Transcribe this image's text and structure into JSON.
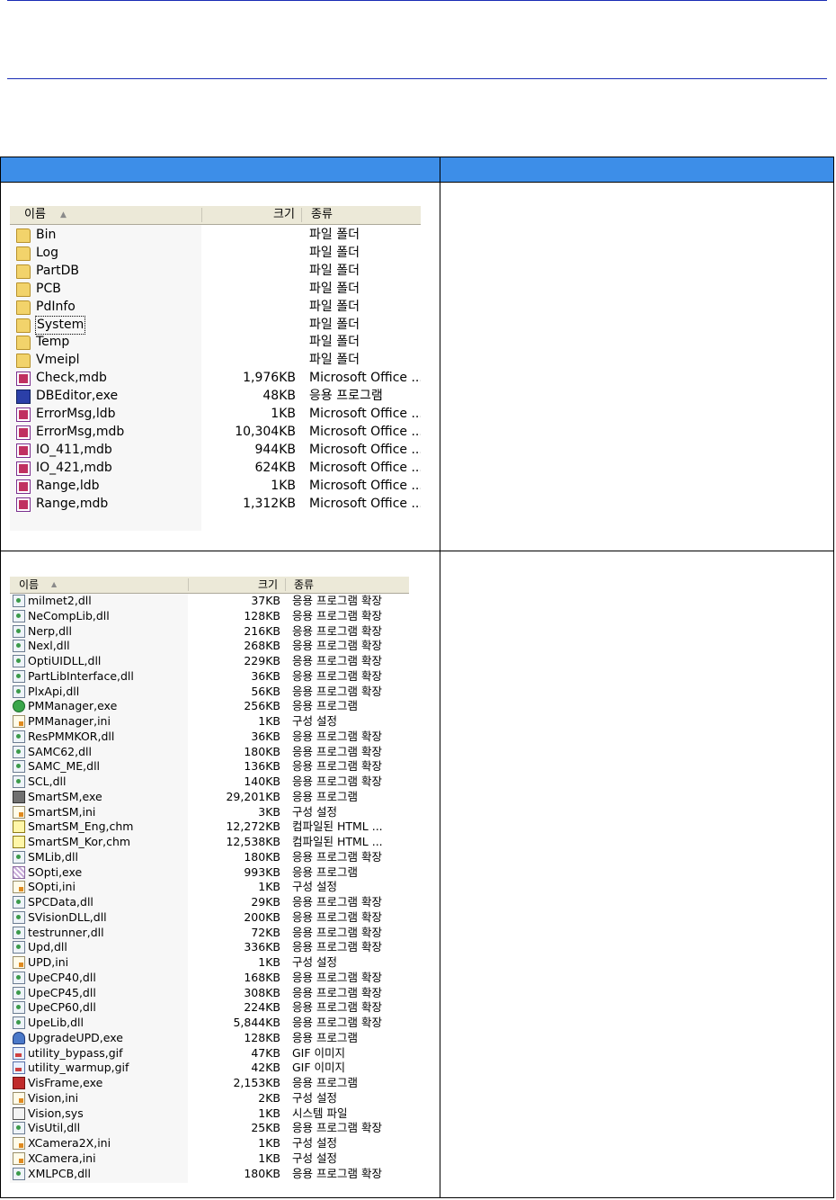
{
  "pane1": {
    "header": {
      "name": "이름",
      "size": "크기",
      "type": "종류"
    },
    "rows": [
      {
        "icon": "folder-icon",
        "name": "Bin",
        "size": "",
        "type": "파일 폴더"
      },
      {
        "icon": "folder-icon",
        "name": "Log",
        "size": "",
        "type": "파일 폴더"
      },
      {
        "icon": "folder-icon",
        "name": "PartDB",
        "size": "",
        "type": "파일 폴더"
      },
      {
        "icon": "folder-icon",
        "name": "PCB",
        "size": "",
        "type": "파일 폴더"
      },
      {
        "icon": "folder-icon",
        "name": "PdInfo",
        "size": "",
        "type": "파일 폴더"
      },
      {
        "icon": "folder-icon",
        "name": "System",
        "size": "",
        "type": "파일 폴더",
        "focused": true
      },
      {
        "icon": "folder-icon",
        "name": "Temp",
        "size": "",
        "type": "파일 폴더"
      },
      {
        "icon": "folder-icon",
        "name": "Vmeipl",
        "size": "",
        "type": "파일 폴더"
      },
      {
        "icon": "mdb-icon",
        "name": "Check,mdb",
        "size": "1,976KB",
        "type": "Microsoft Office ..."
      },
      {
        "icon": "exe-icon",
        "name": "DBEditor,exe",
        "size": "48KB",
        "type": "응용 프로그램"
      },
      {
        "icon": "mdb-icon",
        "name": "ErrorMsg,ldb",
        "size": "1KB",
        "type": "Microsoft Office ..."
      },
      {
        "icon": "mdb-icon",
        "name": "ErrorMsg,mdb",
        "size": "10,304KB",
        "type": "Microsoft Office ..."
      },
      {
        "icon": "mdb-icon",
        "name": "IO_411,mdb",
        "size": "944KB",
        "type": "Microsoft Office ..."
      },
      {
        "icon": "mdb-icon",
        "name": "IO_421,mdb",
        "size": "624KB",
        "type": "Microsoft Office ..."
      },
      {
        "icon": "mdb-icon",
        "name": "Range,ldb",
        "size": "1KB",
        "type": "Microsoft Office ..."
      },
      {
        "icon": "mdb-icon",
        "name": "Range,mdb",
        "size": "1,312KB",
        "type": "Microsoft Office ..."
      }
    ]
  },
  "pane2": {
    "header": {
      "name": "이름",
      "size": "크기",
      "type": "종류"
    },
    "rows": [
      {
        "icon": "dll-icon",
        "name": "milmet2,dll",
        "size": "37KB",
        "type": "응용 프로그램 확장"
      },
      {
        "icon": "dll-icon",
        "name": "NeCompLib,dll",
        "size": "128KB",
        "type": "응용 프로그램 확장"
      },
      {
        "icon": "dll-icon",
        "name": "Nerp,dll",
        "size": "216KB",
        "type": "응용 프로그램 확장"
      },
      {
        "icon": "dll-icon",
        "name": "Nexl,dll",
        "size": "268KB",
        "type": "응용 프로그램 확장"
      },
      {
        "icon": "dll-icon",
        "name": "OptiUIDLL,dll",
        "size": "229KB",
        "type": "응용 프로그램 확장"
      },
      {
        "icon": "dll-icon",
        "name": "PartLibInterface,dll",
        "size": "36KB",
        "type": "응용 프로그램 확장"
      },
      {
        "icon": "dll-icon",
        "name": "PlxApi,dll",
        "size": "56KB",
        "type": "응용 프로그램 확장"
      },
      {
        "icon": "green-exe-icon",
        "name": "PMManager,exe",
        "size": "256KB",
        "type": "응용 프로그램"
      },
      {
        "icon": "ini-icon",
        "name": "PMManager,ini",
        "size": "1KB",
        "type": "구성 설정"
      },
      {
        "icon": "dll-icon",
        "name": "ResPMMKOR,dll",
        "size": "36KB",
        "type": "응용 프로그램 확장"
      },
      {
        "icon": "dll-icon",
        "name": "SAMC62,dll",
        "size": "180KB",
        "type": "응용 프로그램 확장"
      },
      {
        "icon": "dll-icon",
        "name": "SAMC_ME,dll",
        "size": "136KB",
        "type": "응용 프로그램 확장"
      },
      {
        "icon": "dll-icon",
        "name": "SCL,dll",
        "size": "140KB",
        "type": "응용 프로그램 확장"
      },
      {
        "icon": "printer-exe-icon",
        "name": "SmartSM,exe",
        "size": "29,201KB",
        "type": "응용 프로그램"
      },
      {
        "icon": "ini-icon",
        "name": "SmartSM,ini",
        "size": "3KB",
        "type": "구성 설정"
      },
      {
        "icon": "chm-icon",
        "name": "SmartSM_Eng,chm",
        "size": "12,272KB",
        "type": "컴파일된 HTML ..."
      },
      {
        "icon": "chm-icon",
        "name": "SmartSM_Kor,chm",
        "size": "12,538KB",
        "type": "컴파일된 HTML ..."
      },
      {
        "icon": "dll-icon",
        "name": "SMLib,dll",
        "size": "180KB",
        "type": "응용 프로그램 확장"
      },
      {
        "icon": "pattern-exe-icon",
        "name": "SOpti,exe",
        "size": "993KB",
        "type": "응용 프로그램"
      },
      {
        "icon": "ini-icon",
        "name": "SOpti,ini",
        "size": "1KB",
        "type": "구성 설정"
      },
      {
        "icon": "dll-icon",
        "name": "SPCData,dll",
        "size": "29KB",
        "type": "응용 프로그램 확장"
      },
      {
        "icon": "dll-icon",
        "name": "SVisionDLL,dll",
        "size": "200KB",
        "type": "응용 프로그램 확장"
      },
      {
        "icon": "dll-icon",
        "name": "testrunner,dll",
        "size": "72KB",
        "type": "응용 프로그램 확장"
      },
      {
        "icon": "dll-icon",
        "name": "Upd,dll",
        "size": "336KB",
        "type": "응용 프로그램 확장"
      },
      {
        "icon": "ini-icon",
        "name": "UPD,ini",
        "size": "1KB",
        "type": "구성 설정"
      },
      {
        "icon": "dll-icon",
        "name": "UpeCP40,dll",
        "size": "168KB",
        "type": "응용 프로그램 확장"
      },
      {
        "icon": "dll-icon",
        "name": "UpeCP45,dll",
        "size": "308KB",
        "type": "응용 프로그램 확장"
      },
      {
        "icon": "dll-icon",
        "name": "UpeCP60,dll",
        "size": "224KB",
        "type": "응용 프로그램 확장"
      },
      {
        "icon": "dll-icon",
        "name": "UpeLib,dll",
        "size": "5,844KB",
        "type": "응용 프로그램 확장"
      },
      {
        "icon": "user-exe-icon",
        "name": "UpgradeUPD,exe",
        "size": "128KB",
        "type": "응용 프로그램"
      },
      {
        "icon": "gif-icon",
        "name": "utility_bypass,gif",
        "size": "47KB",
        "type": "GIF 이미지"
      },
      {
        "icon": "gif-icon",
        "name": "utility_warmup,gif",
        "size": "42KB",
        "type": "GIF 이미지"
      },
      {
        "icon": "vis-exe-icon",
        "name": "VisFrame,exe",
        "size": "2,153KB",
        "type": "응용 프로그램"
      },
      {
        "icon": "ini-icon",
        "name": "Vision,ini",
        "size": "2KB",
        "type": "구성 설정"
      },
      {
        "icon": "sys-icon",
        "name": "Vision,sys",
        "size": "1KB",
        "type": "시스템 파일"
      },
      {
        "icon": "dll-icon",
        "name": "VisUtil,dll",
        "size": "25KB",
        "type": "응용 프로그램 확장"
      },
      {
        "icon": "ini-icon",
        "name": "XCamera2X,ini",
        "size": "1KB",
        "type": "구성 설정"
      },
      {
        "icon": "ini-icon",
        "name": "XCamera,ini",
        "size": "1KB",
        "type": "구성 설정"
      },
      {
        "icon": "dll-icon",
        "name": "XMLPCB,dll",
        "size": "180KB",
        "type": "응용 프로그램 확장"
      }
    ]
  },
  "colors": {
    "rule": "#1a2cb5",
    "table_header": "#3d8ee8",
    "header_bar": "#ece9d8"
  }
}
